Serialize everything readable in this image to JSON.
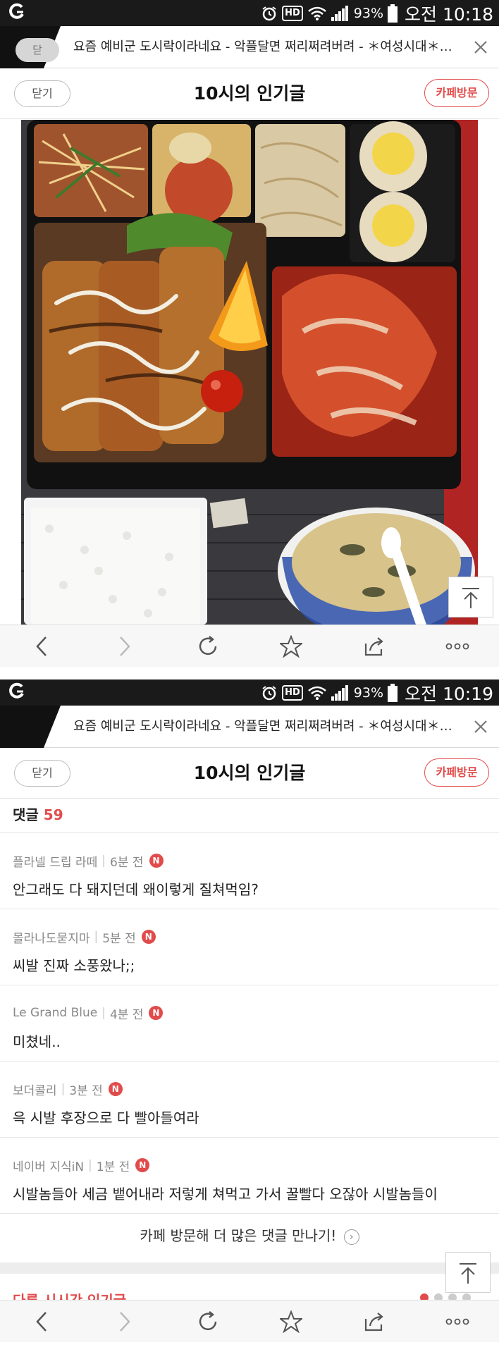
{
  "screens": [
    {
      "status": {
        "battery": "93%",
        "time": "오전 10:18",
        "hd": "HD"
      },
      "tab": {
        "prev_label": "닫",
        "title": "요즘 예비군 도시락이라네요 - 악플달면 쩌리쩌려버려 - ＊여성시대＊ 차..."
      },
      "header": {
        "close": "닫기",
        "title": "10시의 인기글",
        "visit": "카페방문"
      }
    },
    {
      "status": {
        "battery": "93%",
        "time": "오전 10:19",
        "hd": "HD"
      },
      "tab": {
        "title": "요즘 예비군 도시락이라네요 - 악플달면 쩌리쩌려버려 - ＊여성시대＊ 차..."
      },
      "header": {
        "close": "닫기",
        "title": "10시의 인기글",
        "visit": "카페방문"
      },
      "comments": {
        "label": "댓글",
        "count": "59",
        "items": [
          {
            "author": "플라넬 드립 라떼",
            "time": "6분 전",
            "badge": "N",
            "text": "안그래도 다 돼지던데 왜이렇게 질쳐먹임?"
          },
          {
            "author": "몰라나도묻지마",
            "time": "5분 전",
            "badge": "N",
            "text": "씨발 진짜 소풍왔나;;"
          },
          {
            "author": "Le Grand Blue",
            "time": "4분 전",
            "badge": "N",
            "text": "미쳤네.."
          },
          {
            "author": "보더콜리",
            "time": "3분 전",
            "badge": "N",
            "text": "윽 시발 후장으로 다 빨아들여라"
          },
          {
            "author": "네이버 지식iN",
            "time": "1분 전",
            "badge": "N",
            "text": "시발놈들아 세금 뱉어내라 저렇게 쳐먹고 가서 꿀빨다 오잖아 시발놈들이"
          }
        ],
        "more": "카페 방문해 더 많은 댓글 만나기!",
        "more_arrow": "›"
      },
      "next_section": "다른 시시간 인기글"
    }
  ],
  "toolbar_icons": [
    "back-icon",
    "forward-icon",
    "refresh-icon",
    "bookmark-star-icon",
    "share-icon",
    "more-icon"
  ],
  "colors": {
    "accent": "#e24b4b",
    "status_bar": "#1a1a1a",
    "toolbar": "#f7f7f7"
  }
}
